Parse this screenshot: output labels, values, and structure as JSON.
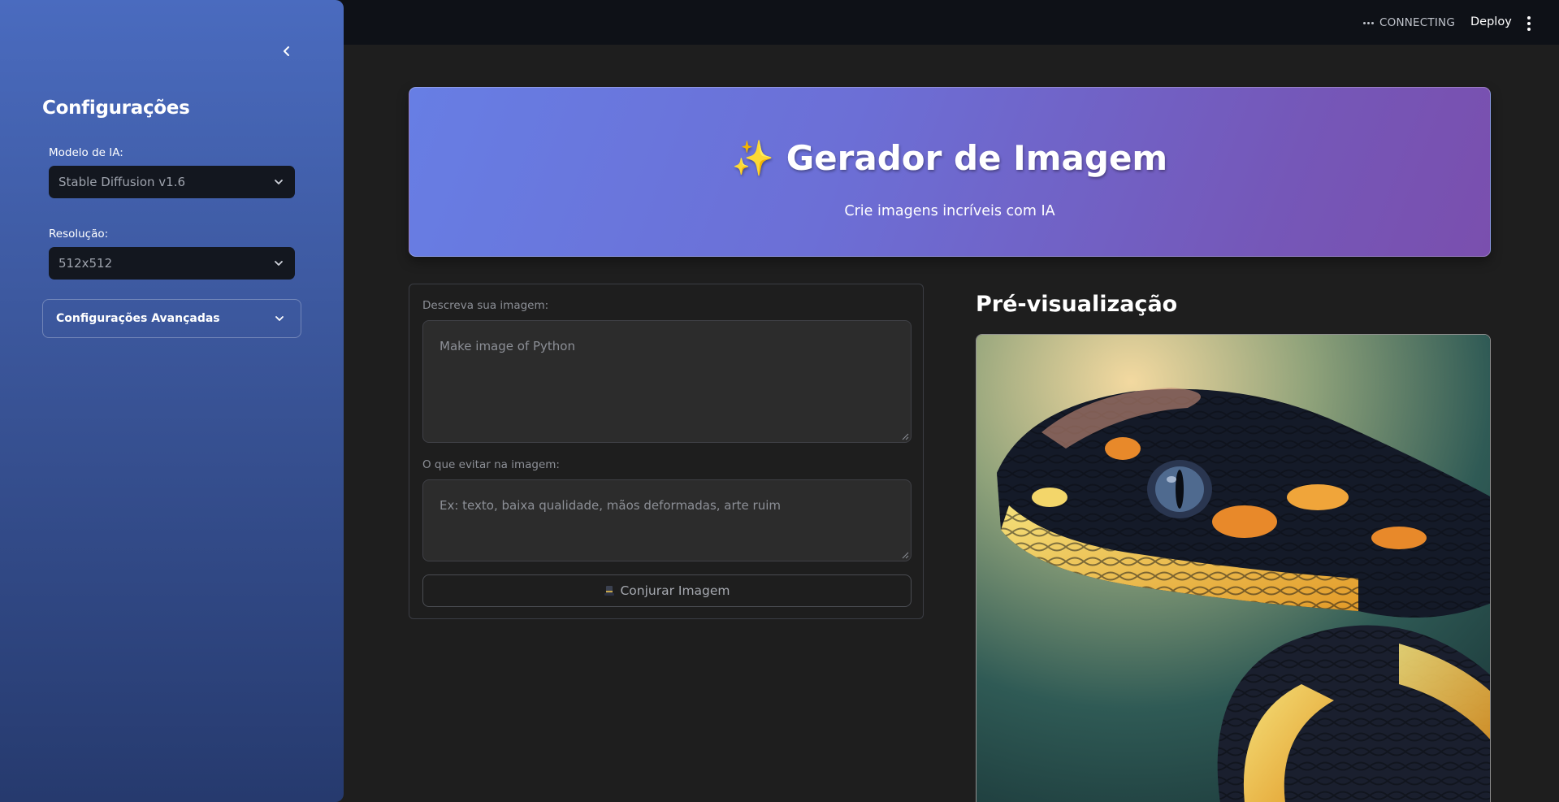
{
  "topbar": {
    "status": "CONNECTING",
    "deploy_label": "Deploy"
  },
  "sidebar": {
    "title": "Configurações",
    "model_label": "Modelo de IA:",
    "model_value": "Stable Diffusion v1.6",
    "resolution_label": "Resolução:",
    "resolution_value": "512x512",
    "advanced_label": "Configurações Avançadas"
  },
  "header": {
    "emoji": "✨",
    "title": "Gerador de Imagem",
    "subtitle": "Crie imagens incríveis com IA"
  },
  "form": {
    "prompt_label": "Descreva sua imagem:",
    "prompt_value": "Make image of Python",
    "negative_label": "O que evitar na imagem:",
    "negative_placeholder": "Ex: texto, baixa qualidade, mãos deformadas, arte ruim",
    "button_label": "Conjurar Imagem"
  },
  "preview": {
    "title": "Pré-visualização"
  },
  "colors": {
    "banner_start": "#677ee4",
    "banner_end": "#7a4fae",
    "sidebar_top": "#4a6bbf",
    "sidebar_bottom": "#263a6e",
    "app_bg": "#1e1e1e",
    "topbar_bg": "#0e1117"
  }
}
